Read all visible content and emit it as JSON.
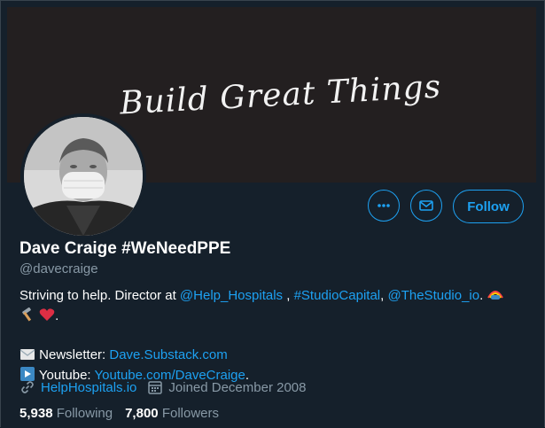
{
  "banner": {
    "text": "Build Great Things"
  },
  "buttons": {
    "follow_label": "Follow"
  },
  "profile": {
    "display_name": "Dave Craige #WeNeedPPE",
    "handle": "@davecraige"
  },
  "bio": {
    "line1_text": "Striving to help. Director at ",
    "mention_help_hospitals": "@Help_Hospitals",
    "sep1": " , ",
    "hashtag_studio_capital": "#StudioCapital",
    "sep2": ", ",
    "mention_thestudio": "@TheStudio_io",
    "after_mention": ". ",
    "period": ".",
    "newsletter_label": "Newsletter: ",
    "newsletter_link": "Dave.Substack.com",
    "youtube_label": "Youtube: ",
    "youtube_link": "Youtube.com/DaveCraige",
    "youtube_period": "."
  },
  "meta": {
    "website": "HelpHospitals.io",
    "joined": "Joined December 2008"
  },
  "stats": {
    "following_count": "5,938",
    "following_label": "Following",
    "followers_count": "7,800",
    "followers_label": "Followers"
  },
  "icons": {
    "more": "more-icon",
    "message": "envelope-icon",
    "link": "link-icon",
    "calendar": "calendar-icon",
    "newsletter": "envelope-emoji",
    "youtube": "play-button-emoji"
  },
  "colors": {
    "background": "#15202b",
    "accent": "#1da1f2",
    "secondary_text": "#8899a6",
    "banner": "#231f20"
  }
}
